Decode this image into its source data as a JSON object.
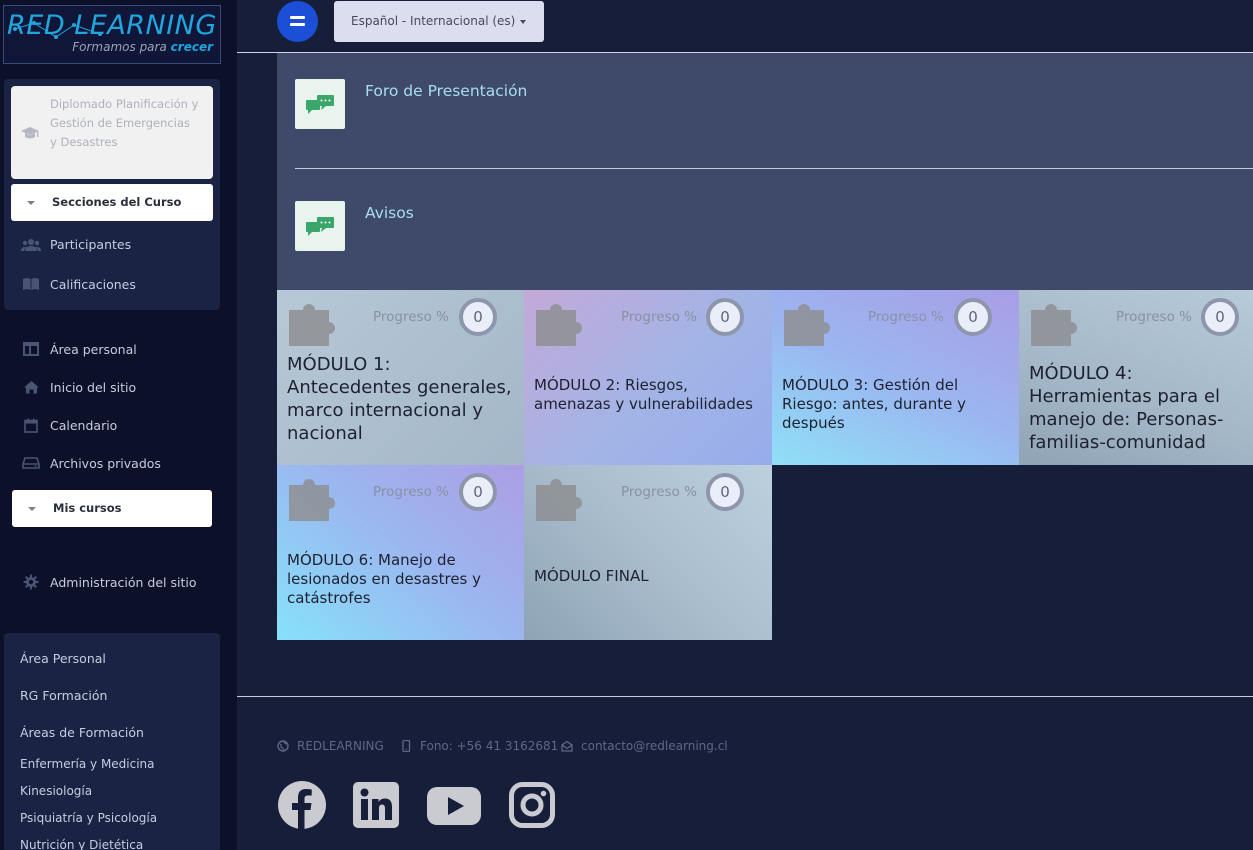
{
  "brand": {
    "logo_main": "RED LEARNING",
    "logo_sub_prefix": "Formamos para",
    "logo_sub_emphasis": "crecer"
  },
  "course": {
    "title": "Diplomado Planificación y Gestión de Emergencias y Desastres",
    "sections_label": "Secciones del Curso",
    "items": [
      {
        "label": "Participantes",
        "icon": "users-icon"
      },
      {
        "label": "Calificaciones",
        "icon": "book-icon"
      }
    ]
  },
  "nav": {
    "items": [
      {
        "label": "Área personal",
        "icon": "dashboard-icon"
      },
      {
        "label": "Inicio del sitio",
        "icon": "home-icon"
      },
      {
        "label": "Calendario",
        "icon": "calendar-icon"
      },
      {
        "label": "Archivos privados",
        "icon": "drive-icon"
      }
    ],
    "my_courses_label": "Mis cursos",
    "admin_label": "Administración del sitio"
  },
  "links": {
    "items": [
      "Área Personal",
      "RG Formación",
      "Áreas de Formación"
    ],
    "sub_items": [
      "Enfermería y Medicina",
      "Kinesiología",
      "Psiquiatría y Psicología",
      "Nutrición y Dietética"
    ]
  },
  "topbar": {
    "language": "Español - Internacional (es)"
  },
  "forums": [
    {
      "label": "Foro de Presentación",
      "icon": "forum-icon"
    },
    {
      "label": "Avisos",
      "icon": "forum-icon"
    }
  ],
  "modules": [
    {
      "title": "MÓDULO 1: Antecedentes generales, marco internacional y nacional",
      "progress_label": "Progreso %",
      "progress": "0"
    },
    {
      "title": "MÓDULO 2: Riesgos, amenazas y vulnerabilidades",
      "progress_label": "Progreso %",
      "progress": "0"
    },
    {
      "title": "MÓDULO 3: Gestión del Riesgo: antes, durante y después",
      "progress_label": "Progreso %",
      "progress": "0"
    },
    {
      "title": "MÓDULO 4: Herramientas para el manejo de: Personas-familias-comunidad",
      "progress_label": "Progreso %",
      "progress": "0"
    },
    {
      "title": "MÓDULO 6: Manejo de lesionados en desastres y catástrofes",
      "progress_label": "Progreso %",
      "progress": "0"
    },
    {
      "title": "MÓDULO FINAL",
      "progress_label": "Progreso %",
      "progress": "0"
    }
  ],
  "footer": {
    "site": "REDLEARNING",
    "phone": "Fono: +56 41 3162681",
    "email": "contacto@redlearning.cl",
    "social": [
      "facebook-icon",
      "linkedin-icon",
      "youtube-icon",
      "instagram-icon"
    ]
  },
  "colors": {
    "accent": "#1a4fd6",
    "brand_blue": "#1fa6de",
    "forum_title": "#a8dcf6",
    "sidebar_bg": "#0c1028",
    "content_bg": "#161e3a",
    "forum_panel": "#3f4a6a"
  }
}
